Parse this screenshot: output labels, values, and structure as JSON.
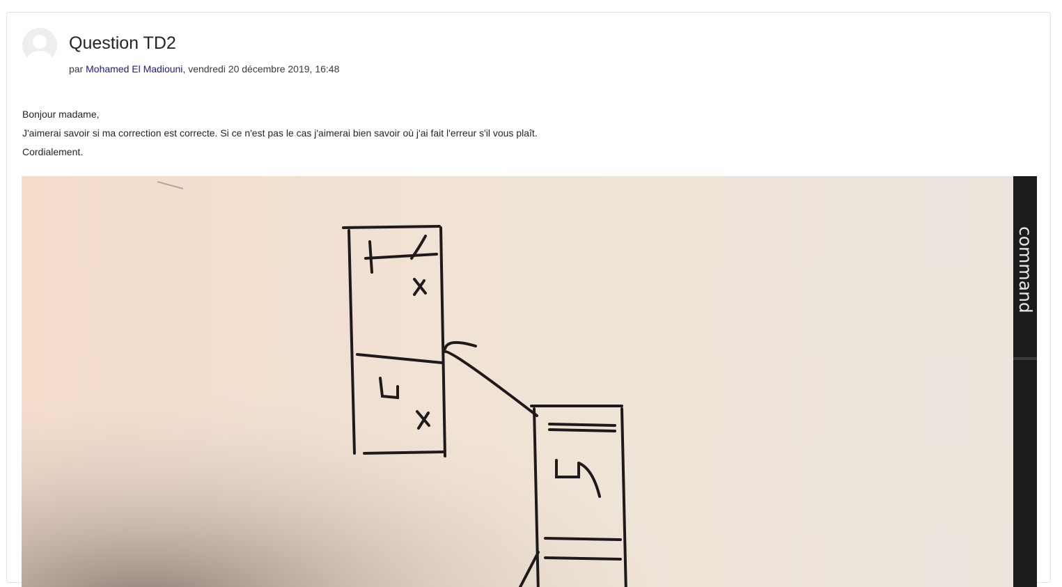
{
  "post": {
    "title": "Question TD2",
    "byline_prefix": "par ",
    "author": "Mohamed El Madiouni",
    "byline_suffix": ", vendredi 20 décembre 2019, 16:48",
    "message": [
      "Bonjour madame,",
      "J'aimerai savoir si ma correction est correcte. Si ce n'est pas le cas j'aimerai bien savoir où j'ai fait l'erreur s'il vous plaît.",
      "Cordialement."
    ],
    "attachment": {
      "sidebar_text": "command"
    }
  },
  "colors": {
    "author_link": "#1a1a8f",
    "paper": "#f0e2d6",
    "ink": "#1e1a1c",
    "notebook_edge": "#1c1c1c"
  }
}
